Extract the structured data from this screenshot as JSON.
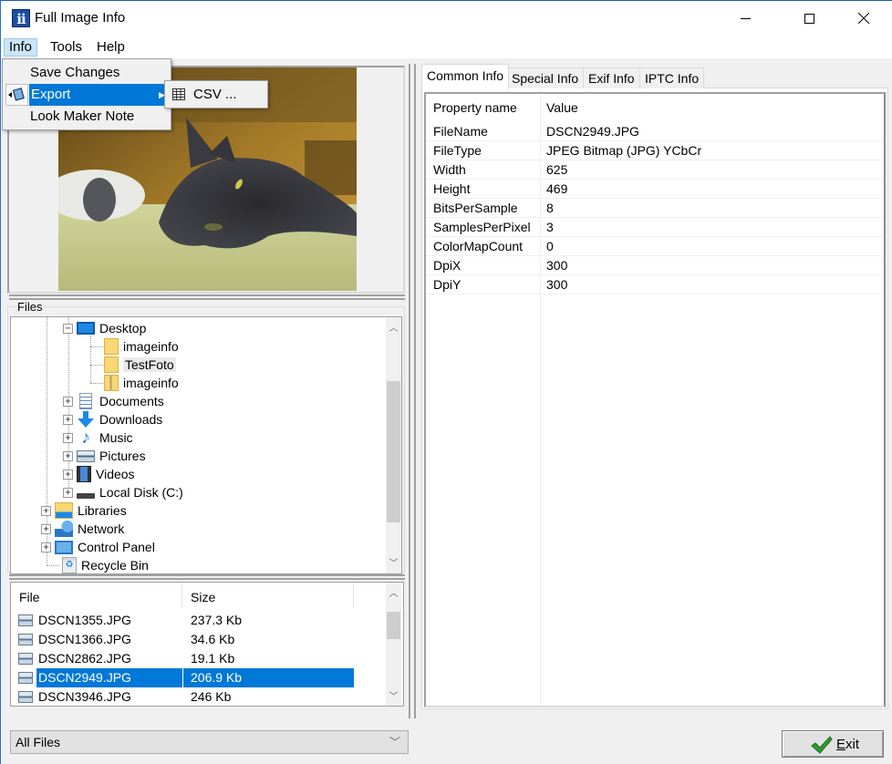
{
  "window": {
    "title": "Full Image Info",
    "app_icon_text": "ii",
    "controls": {
      "minimize": "minimize-icon",
      "maximize": "maximize-icon",
      "close": "close-icon"
    }
  },
  "menubar": {
    "items": [
      {
        "label": "Info",
        "active": true
      },
      {
        "label": "Tools",
        "active": false
      },
      {
        "label": "Help",
        "active": false
      }
    ]
  },
  "info_menu": {
    "items": [
      {
        "label": "Save Changes",
        "highlighted": false
      },
      {
        "label": "Export",
        "highlighted": true,
        "has_submenu": true,
        "icon": "export-icon"
      },
      {
        "label": "Look Maker Note",
        "highlighted": false
      }
    ],
    "export_submenu": {
      "items": [
        {
          "label": "CSV ...",
          "icon": "table-icon"
        }
      ]
    }
  },
  "files_panel": {
    "legend": "Files",
    "tree": [
      {
        "label": "Desktop",
        "level": 2,
        "expander": "-",
        "icon": "desktop-icon"
      },
      {
        "label": "imageinfo",
        "level": 3,
        "expander": null,
        "icon": "folder-icon"
      },
      {
        "label": "TestFoto",
        "level": 3,
        "expander": null,
        "icon": "folder-icon",
        "highlighted": true
      },
      {
        "label": "imageinfo",
        "level": 3,
        "expander": null,
        "icon": "zip-folder-icon"
      },
      {
        "label": "Documents",
        "level": 2,
        "expander": "+",
        "icon": "documents-icon"
      },
      {
        "label": "Downloads",
        "level": 2,
        "expander": "+",
        "icon": "downloads-icon"
      },
      {
        "label": "Music",
        "level": 2,
        "expander": "+",
        "icon": "music-icon"
      },
      {
        "label": "Pictures",
        "level": 2,
        "expander": "+",
        "icon": "pictures-icon"
      },
      {
        "label": "Videos",
        "level": 2,
        "expander": "+",
        "icon": "videos-icon"
      },
      {
        "label": "Local Disk (C:)",
        "level": 2,
        "expander": "+",
        "icon": "drive-icon"
      },
      {
        "label": "Libraries",
        "level": 1,
        "expander": "+",
        "icon": "libraries-icon"
      },
      {
        "label": "Network",
        "level": 1,
        "expander": "+",
        "icon": "network-icon"
      },
      {
        "label": "Control Panel",
        "level": 1,
        "expander": "+",
        "icon": "control-panel-icon"
      },
      {
        "label": "Recycle Bin",
        "level": 1,
        "expander": null,
        "icon": "recycle-bin-icon"
      }
    ]
  },
  "file_list": {
    "columns": [
      "File",
      "Size"
    ],
    "rows": [
      {
        "name": "DSCN1355.JPG",
        "size": "237.3 Kb",
        "selected": false
      },
      {
        "name": "DSCN1366.JPG",
        "size": "34.6 Kb",
        "selected": false
      },
      {
        "name": "DSCN2862.JPG",
        "size": "19.1 Kb",
        "selected": false
      },
      {
        "name": "DSCN2949.JPG",
        "size": "206.9 Kb",
        "selected": true
      },
      {
        "name": "DSCN3946.JPG",
        "size": "246 Kb",
        "selected": false
      }
    ]
  },
  "filter": {
    "selected": "All Files"
  },
  "tabs": [
    {
      "label": "Common Info",
      "active": true
    },
    {
      "label": "Special Info",
      "active": false
    },
    {
      "label": "Exif Info",
      "active": false
    },
    {
      "label": "IPTC Info",
      "active": false
    }
  ],
  "properties": {
    "columns": [
      "Property name",
      "Value"
    ],
    "rows": [
      {
        "name": "FileName",
        "value": "DSCN2949.JPG"
      },
      {
        "name": "FileType",
        "value": "JPEG Bitmap (JPG) YCbCr"
      },
      {
        "name": "Width",
        "value": "625"
      },
      {
        "name": "Height",
        "value": "469"
      },
      {
        "name": "BitsPerSample",
        "value": "8"
      },
      {
        "name": "SamplesPerPixel",
        "value": "3"
      },
      {
        "name": "ColorMapCount",
        "value": "0"
      },
      {
        "name": "DpiX",
        "value": "300"
      },
      {
        "name": "DpiY",
        "value": "300"
      }
    ]
  },
  "exit_button": {
    "label_accel": "E",
    "label_rest": "xit",
    "icon": "checkmark-icon"
  },
  "colors": {
    "selection": "#0078d7",
    "menu_active": "#cce4f7",
    "check_green": "#2e9b2e"
  }
}
